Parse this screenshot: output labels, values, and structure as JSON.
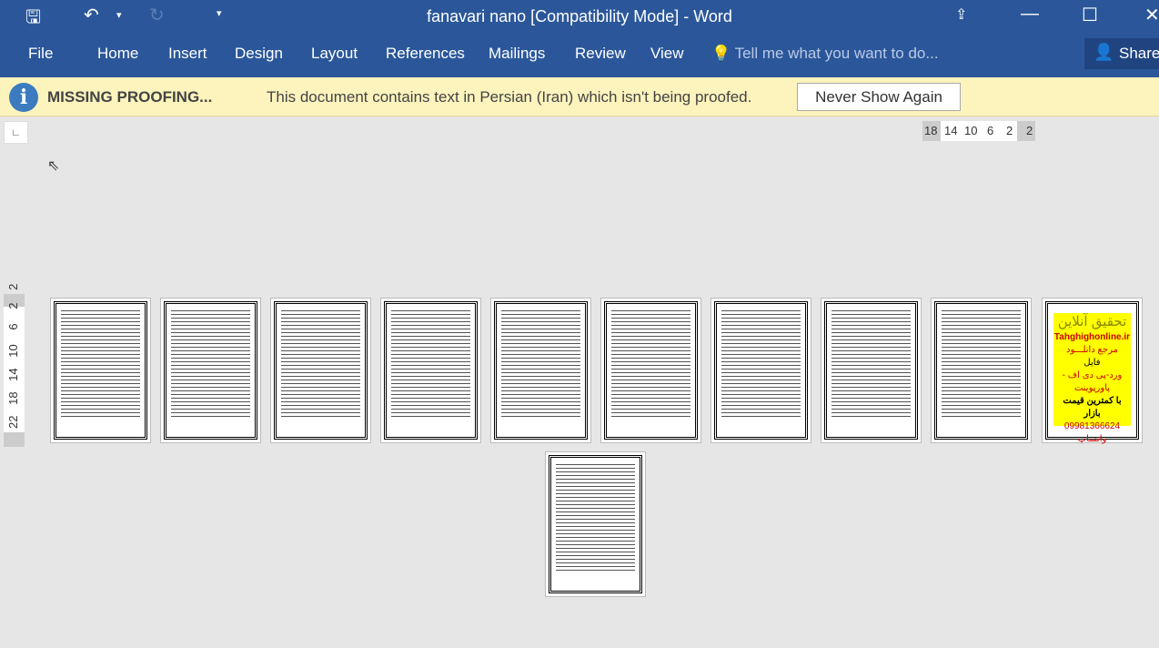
{
  "window": {
    "title": "fanavari nano [Compatibility Mode] - Word"
  },
  "ribbon": {
    "tabs": [
      "File",
      "Home",
      "Insert",
      "Design",
      "Layout",
      "References",
      "Mailings",
      "Review",
      "View"
    ],
    "tell_me": "Tell me what you want to do...",
    "share": "Share"
  },
  "message_bar": {
    "title": "MISSING PROOFING...",
    "text": "This document contains text in Persian (Iran) which isn't being proofed.",
    "button": "Never Show Again"
  },
  "horizontal_ruler": [
    "18",
    "14",
    "10",
    "6",
    "2",
    "2"
  ],
  "vertical_ruler": [
    "22",
    "18",
    "14",
    "10",
    "6",
    "2",
    "2"
  ],
  "pages": {
    "count": 11,
    "ad": {
      "title": "تحقیق آنلاین",
      "site": "Tahghighonline.ir",
      "line1": "مرجع دانلـــود",
      "line2": "فایل",
      "line3": "ورد-پی دی اف - پاورپوینت",
      "line4": "با کمترین قیمت بازار",
      "phone": "09981366624 واتساپ"
    }
  },
  "colors": {
    "titlebar": "#2b579a",
    "message_bar": "#fcf3bd",
    "canvas": "#e6e6e6"
  }
}
